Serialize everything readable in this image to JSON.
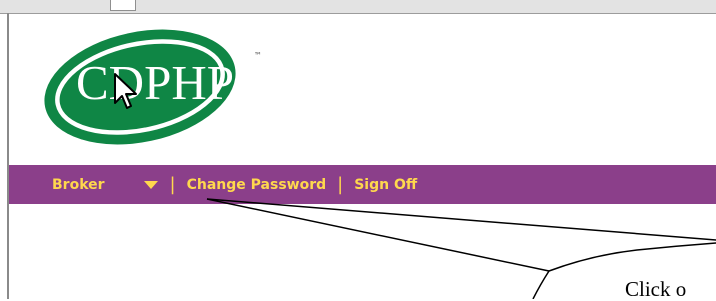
{
  "brand": {
    "logo_text": "CDPHP",
    "trademark": "™",
    "colors": {
      "logo_green": "#0f8645",
      "nav_purple": "#8b3f8a",
      "nav_text": "#ffd84d"
    }
  },
  "nav": {
    "items": [
      {
        "label": "Broker"
      },
      {
        "label": "Change Password"
      },
      {
        "label": "Sign Off"
      }
    ],
    "separator": "|",
    "dropdown_icon": "chevron-down-icon"
  },
  "callout": {
    "text": "Click o"
  },
  "icons": {
    "cursor": "mouse-pointer-icon",
    "logo": "cdphp-logo"
  }
}
